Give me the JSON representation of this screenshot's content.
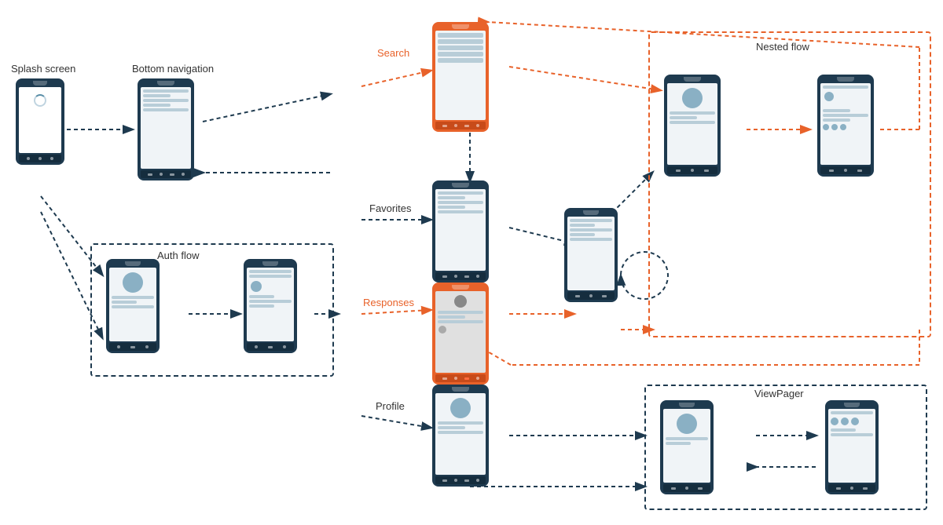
{
  "labels": {
    "splash_screen": "Splash screen",
    "bottom_navigation": "Bottom navigation",
    "auth_flow": "Auth flow",
    "search": "Search",
    "favorites": "Favorites",
    "responses": "Responses",
    "profile": "Profile",
    "nested_flow": "Nested flow",
    "viewpager": "ViewPager"
  },
  "colors": {
    "dark": "#1e3a4f",
    "orange": "#e8622a",
    "arrow_dark": "#1e3a4f",
    "arrow_orange": "#e8622a",
    "bg": "#ffffff"
  }
}
